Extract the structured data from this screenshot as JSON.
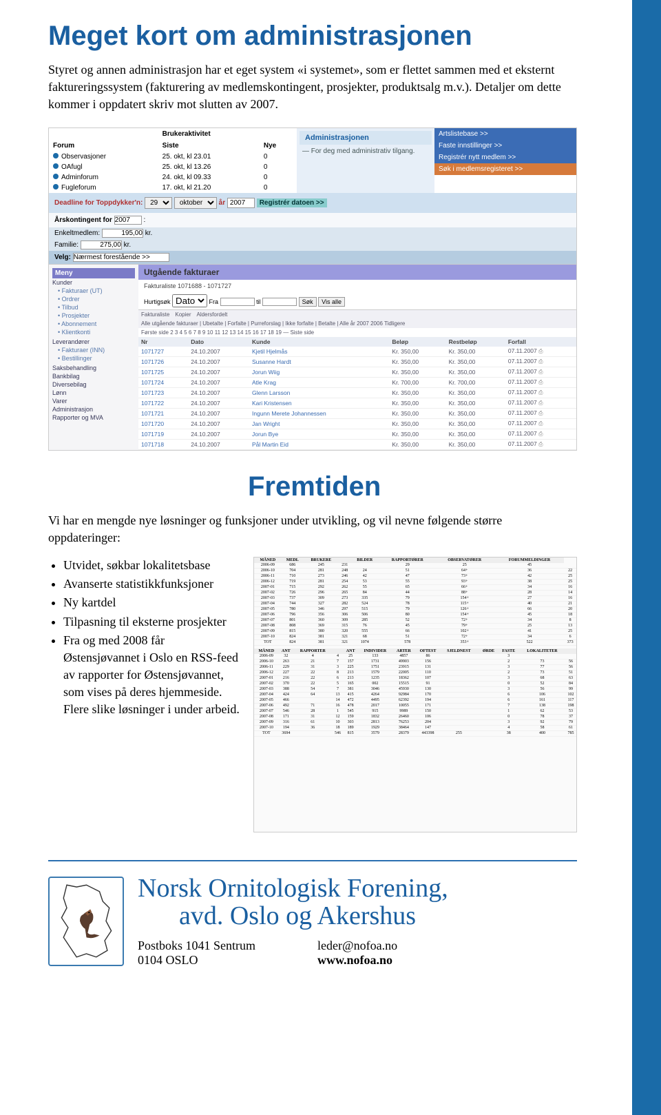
{
  "heading1": "Meget kort om administrasjonen",
  "para1": "Styret og annen administrasjon har et eget system «i systemet», som er flettet sammen med et eksternt faktureringssystem (fakturering av medlemskontingent, prosjekter, produktsalg m.v.). Detaljer om dette kommer i oppdatert skriv mot slutten av 2007.",
  "forum": {
    "header_activity": "Brukeraktivitet",
    "col_forum": "Forum",
    "col_siste": "Siste",
    "col_nye": "Nye",
    "rows": [
      {
        "name": "Observasjoner",
        "siste": "25. okt, kl 23.01",
        "nye": "0"
      },
      {
        "name": "OAfugl",
        "siste": "25. okt, kl 13.26",
        "nye": "0"
      },
      {
        "name": "Adminforum",
        "siste": "24. okt, kl 09.33",
        "nye": "0"
      },
      {
        "name": "Fugleforum",
        "siste": "17. okt, kl 21.20",
        "nye": "0"
      }
    ]
  },
  "admin_block": {
    "header": "Administrasjonen",
    "sub": "— For deg med administrativ tilgang.",
    "links": [
      "Artslistebase >>",
      "Faste innstillinger >>",
      "Registrér nytt medlem >>",
      "Søk i medlemsregisteret >>"
    ]
  },
  "deadline": {
    "label": "Deadline for Toppdykker'n:",
    "day": "29",
    "month": "oktober",
    "year_label": "år",
    "year": "2007",
    "button": "Registrér datoen >>"
  },
  "kontingent": {
    "header": "Årskontingent for",
    "year": "2007",
    "row1": {
      "label": "Enkeltmedlem:",
      "value": "195,00",
      "suffix": "kr."
    },
    "row2": {
      "label": "Familie:",
      "value": "275,00",
      "suffix": "kr."
    }
  },
  "velg": {
    "label": "Velg:",
    "value": "Nærmest forestående >>"
  },
  "meny": {
    "header": "Meny",
    "items": [
      "Kunder",
      "• Fakturaer (UT)",
      "• Ordrer",
      "• Tilbud",
      "• Prosjekter",
      "• Abonnement",
      "• Klientkonti",
      "",
      "Leverandører",
      "• Fakturaer (INN)",
      "• Bestillinger",
      "",
      "Saksbehandling",
      "Bankbilag",
      "Diversebilag",
      "Lønn",
      "Varer",
      "Administrasjon",
      "Rapporter og MVA"
    ]
  },
  "fakturer": {
    "header": "Utgående fakturaer",
    "sub": "Fakturaliste 1071688 - 1071727",
    "search": {
      "label": "Hurtigsøk",
      "field": "Dato",
      "fra": "Fra",
      "til": "til",
      "btn_sok": "Søk",
      "btn_alle": "Vis alle"
    },
    "tabs": [
      "Fakturaliste",
      "Kopier",
      "Aldersfordelt"
    ],
    "filterbar": "Alle utgående fakturaer | Ubetalte | Forfalte | Purreforslag | Ikke forfalte | Betalte | Alle år 2007 2006 Tidligere",
    "pages": "Første side  2  3  4  5  6  7  8  9  10  11  12  13  14  15  16  17  18  19  —  Siste side",
    "cols": [
      "Nr",
      "Dato",
      "Kunde",
      "Beløp",
      "Restbeløp",
      "Forfall"
    ],
    "rows": [
      {
        "nr": "1071727",
        "dato": "24.10.2007",
        "kunde": "Kjetil Hjelmås",
        "belop": "Kr. 350,00",
        "rest": "Kr. 350,00",
        "forfall": "07.11.2007"
      },
      {
        "nr": "1071726",
        "dato": "24.10.2007",
        "kunde": "Susanne Hardt",
        "belop": "Kr. 350,00",
        "rest": "Kr. 350,00",
        "forfall": "07.11.2007"
      },
      {
        "nr": "1071725",
        "dato": "24.10.2007",
        "kunde": "Jorun Wiig",
        "belop": "Kr. 350,00",
        "rest": "Kr. 350,00",
        "forfall": "07.11.2007"
      },
      {
        "nr": "1071724",
        "dato": "24.10.2007",
        "kunde": "Atle Krag",
        "belop": "Kr. 700,00",
        "rest": "Kr. 700,00",
        "forfall": "07.11.2007"
      },
      {
        "nr": "1071723",
        "dato": "24.10.2007",
        "kunde": "Glenn Larsson",
        "belop": "Kr. 350,00",
        "rest": "Kr. 350,00",
        "forfall": "07.11.2007"
      },
      {
        "nr": "1071722",
        "dato": "24.10.2007",
        "kunde": "Kari Kristensen",
        "belop": "Kr. 350,00",
        "rest": "Kr. 350,00",
        "forfall": "07.11.2007"
      },
      {
        "nr": "1071721",
        "dato": "24.10.2007",
        "kunde": "Ingunn Merete Johannessen",
        "belop": "Kr. 350,00",
        "rest": "Kr. 350,00",
        "forfall": "07.11.2007"
      },
      {
        "nr": "1071720",
        "dato": "24.10.2007",
        "kunde": "Jan Wright",
        "belop": "Kr. 350,00",
        "rest": "Kr. 350,00",
        "forfall": "07.11.2007"
      },
      {
        "nr": "1071719",
        "dato": "24.10.2007",
        "kunde": "Jorun Bye",
        "belop": "Kr. 350,00",
        "rest": "Kr. 350,00",
        "forfall": "07.11.2007"
      },
      {
        "nr": "1071718",
        "dato": "24.10.2007",
        "kunde": "Pål Martin Eid",
        "belop": "Kr. 350,00",
        "rest": "Kr. 350,00",
        "forfall": "07.11.2007"
      }
    ]
  },
  "heading2": "Fremtiden",
  "para2": "Vi har en mengde nye løsninger og funksjoner under utvikling, og vil nevne følgende større oppdateringer:",
  "bullets": [
    "Utvidet, søkbar lokalitetsbase",
    "Avanserte statistikkfunksjoner",
    "Ny kartdel",
    "Tilpasning til eksterne prosjekter",
    "Fra og med 2008 får Østensjøvannet i Oslo en RSS-feed av rapporter for Østensjøvannet, som vises på deres hjemmeside. Flere slike løsninger i under arbeid."
  ],
  "stats_headers": [
    "MÅNED",
    "MEDL",
    "BRUKERE",
    "",
    "BILDER",
    "",
    "RAPPORTØRER",
    "",
    "OBSERVATØRER",
    "",
    "FORUMMELDINGER"
  ],
  "stats_rows": [
    [
      "2006-09",
      "686",
      "245",
      "231",
      "",
      "",
      "29",
      "",
      "25",
      "",
      "45",
      ""
    ],
    [
      "2006-10",
      "704",
      "281",
      "248",
      "24",
      "",
      "51",
      "",
      "64+",
      "",
      "36",
      "22"
    ],
    [
      "2006-11",
      "710",
      "273",
      "246",
      "42",
      "",
      "47",
      "",
      "73+",
      "",
      "42",
      "25"
    ],
    [
      "2006-12",
      "719",
      "281",
      "254",
      "53",
      "",
      "55",
      "",
      "93+",
      "",
      "38",
      "25"
    ],
    [
      "2007-01",
      "715",
      "292",
      "262",
      "55",
      "",
      "65",
      "",
      "66+",
      "",
      "34",
      "16"
    ],
    [
      "2007-02",
      "726",
      "296",
      "265",
      "84",
      "",
      "44",
      "",
      "88+",
      "",
      "28",
      "14"
    ],
    [
      "2007-03",
      "737",
      "309",
      "273",
      "335",
      "",
      "79",
      "",
      "154+",
      "",
      "27",
      "16"
    ],
    [
      "2007-04",
      "744",
      "327",
      "282",
      "524",
      "",
      "78",
      "",
      "115+",
      "",
      "40",
      "21"
    ],
    [
      "2007-05",
      "780",
      "346",
      "297",
      "515",
      "",
      "79",
      "",
      "126+",
      "",
      "66",
      "20"
    ],
    [
      "2007-06",
      "796",
      "356",
      "306",
      "506",
      "",
      "80",
      "",
      "154+",
      "",
      "45",
      "18"
    ],
    [
      "2007-07",
      "801",
      "360",
      "309",
      "285",
      "",
      "52",
      "",
      "72+",
      "",
      "34",
      "8"
    ],
    [
      "2007-08",
      "808",
      "369",
      "315",
      "76",
      "",
      "45",
      "",
      "79+",
      "",
      "25",
      "13"
    ],
    [
      "2007-09",
      "815",
      "380",
      "320",
      "555",
      "",
      "66",
      "",
      "102+",
      "",
      "41",
      "25"
    ],
    [
      "2007-10",
      "824",
      "381",
      "321",
      "68",
      "",
      "51",
      "",
      "72+",
      "",
      "34",
      "6"
    ],
    [
      "TOT",
      "824",
      "381",
      "321",
      "1074",
      "",
      "578",
      "",
      "353+",
      "",
      "522",
      "373"
    ]
  ],
  "loc_headers": [
    "MÅNED",
    "ANT",
    "RAPPORTER",
    "",
    "ANT",
    "INDIVIDER",
    "ARTER",
    "OFTEST",
    "SJELDNEST",
    "",
    "ØRDE",
    "FASTE",
    "LOKALITETER",
    ""
  ],
  "loc_rows": [
    [
      "2006-09",
      "32",
      "4",
      "4",
      "25",
      "133",
      "4857",
      "86",
      "",
      "",
      "",
      "3",
      "",
      ""
    ],
    [
      "2006-10",
      "263",
      "21",
      "7",
      "157",
      "1731",
      "49903",
      "156",
      "",
      "",
      "",
      "2",
      "73",
      "56"
    ],
    [
      "2006-11",
      "229",
      "31",
      "3",
      "225",
      "1751",
      "23915",
      "131",
      "",
      "",
      "",
      "3",
      "77",
      "56"
    ],
    [
      "2006-12",
      "227",
      "22",
      "8",
      "213",
      "1579",
      "22005",
      "110",
      "",
      "",
      "",
      "2",
      "73",
      "51"
    ],
    [
      "2007-01",
      "216",
      "22",
      "6",
      "213",
      "1235",
      "18362",
      "107",
      "",
      "",
      "",
      "3",
      "68",
      "63"
    ],
    [
      "2007-02",
      "370",
      "22",
      "5",
      "165",
      "002",
      "15515",
      "91",
      "",
      "",
      "",
      "0",
      "52",
      "84"
    ],
    [
      "2007-03",
      "388",
      "54",
      "7",
      "381",
      "3046",
      "45930",
      "130",
      "",
      "",
      "",
      "3",
      "56",
      "99"
    ],
    [
      "2007-04",
      "424",
      "64",
      "13",
      "415",
      "4264",
      "92984",
      "170",
      "",
      "",
      "",
      "6",
      "106",
      "102"
    ],
    [
      "2007-05",
      "466",
      "",
      "14",
      "472",
      "4495",
      "62392",
      "194",
      "",
      "",
      "",
      "6",
      "161",
      "117"
    ],
    [
      "2007-06",
      "492",
      "71",
      "16",
      "478",
      "2017",
      "10055",
      "171",
      "",
      "",
      "",
      "7",
      "138",
      "198"
    ],
    [
      "2007-07",
      "546",
      "28",
      "1",
      "545",
      "915",
      "9989",
      "150",
      "",
      "",
      "",
      "1",
      "62",
      "53"
    ],
    [
      "2007-08",
      "171",
      "31",
      "12",
      "159",
      "1832",
      "26460",
      "106",
      "",
      "",
      "",
      "0",
      "78",
      "37"
    ],
    [
      "2007-09",
      "316",
      "61",
      "10",
      "303",
      "2813",
      "76253",
      "204",
      "",
      "",
      "",
      "3",
      "92",
      "79"
    ],
    [
      "2007-10",
      "194",
      "36",
      "18",
      "189",
      "1929",
      "38464",
      "147",
      "",
      "",
      "",
      "4",
      "58",
      "61"
    ],
    [
      "TOT",
      "3694",
      "",
      "546",
      "815",
      "3579",
      "28379",
      "443398",
      "255",
      "",
      "",
      "38",
      "400",
      "785"
    ]
  ],
  "org": {
    "name1": "Norsk Ornitologisk Forening,",
    "name2": "avd. Oslo og Akershus",
    "addr1": "Postboks 1041 Sentrum",
    "addr2": "0104 OSLO",
    "email": "leder@nofoa.no",
    "site": "www.nofoa.no"
  }
}
